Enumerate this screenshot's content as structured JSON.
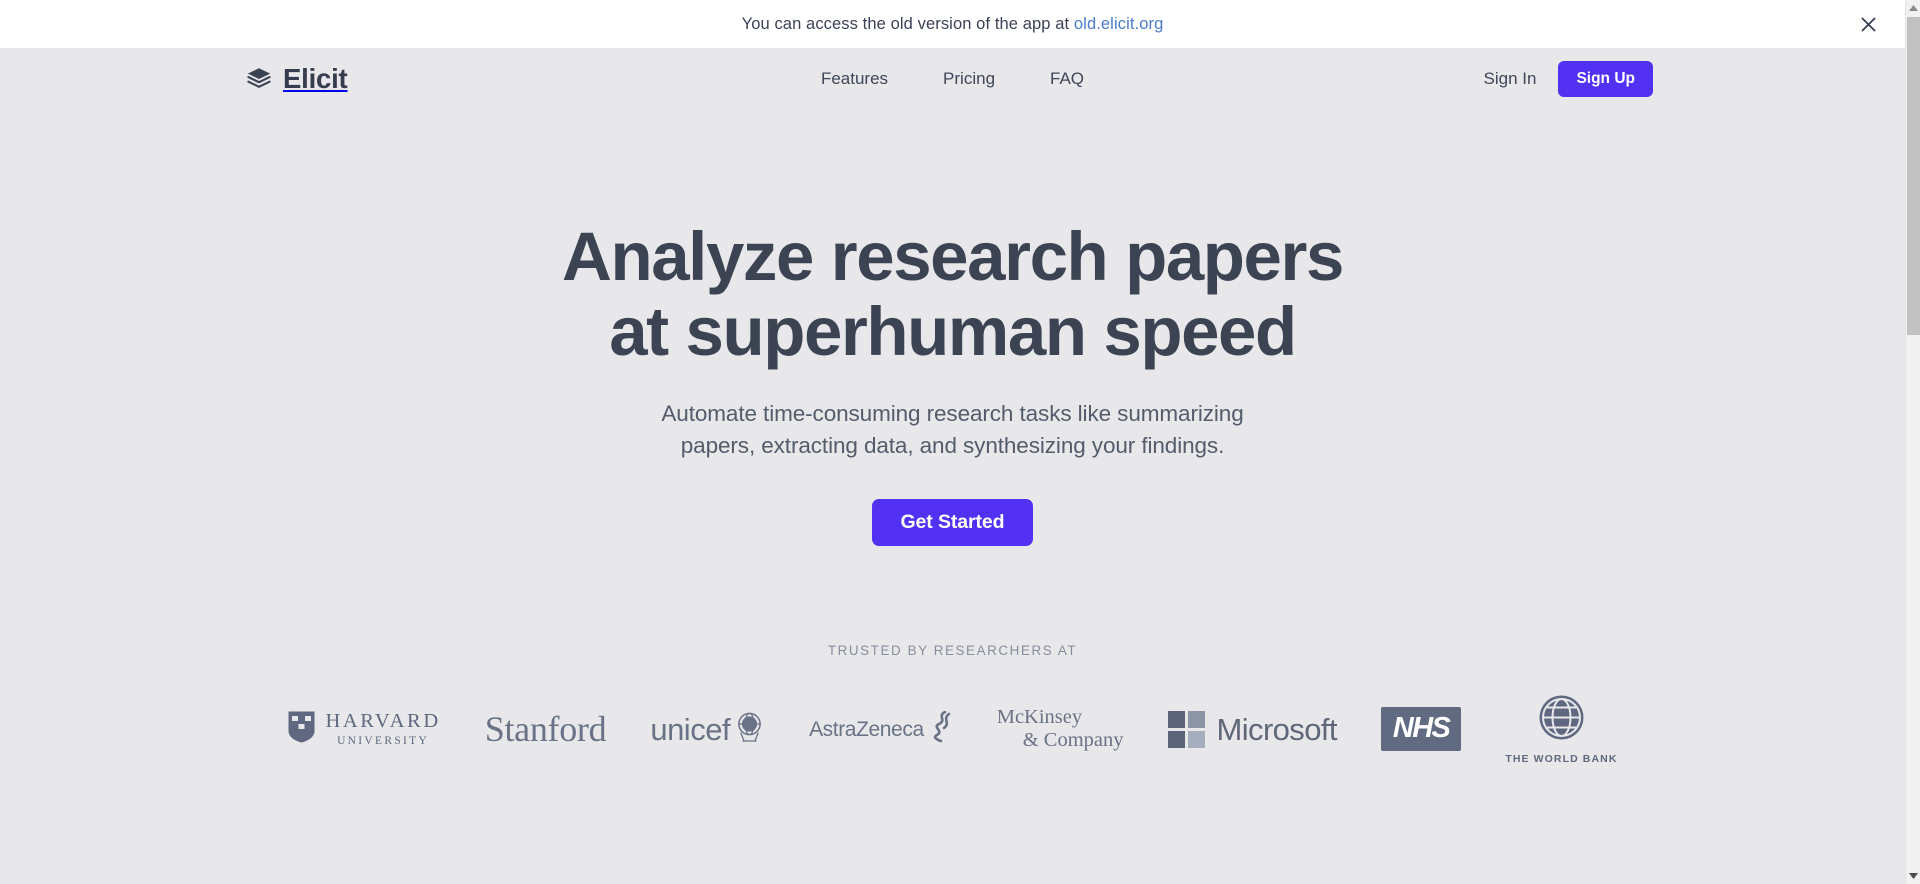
{
  "banner": {
    "text_before": "You can access the old version of the app at ",
    "link_label": "old.elicit.org",
    "close_icon": "close-icon"
  },
  "header": {
    "brand": {
      "name": "Elicit",
      "icon": "stacked-layers-icon"
    },
    "nav": [
      {
        "label": "Features"
      },
      {
        "label": "Pricing"
      },
      {
        "label": "FAQ"
      }
    ],
    "sign_in_label": "Sign In",
    "sign_up_label": "Sign Up"
  },
  "hero": {
    "title_line1": "Analyze research papers",
    "title_line2": "at superhuman speed",
    "subtitle_line1": "Automate time-consuming research tasks like summarizing",
    "subtitle_line2": "papers, extracting data, and synthesizing your findings.",
    "cta_label": "Get Started"
  },
  "trusted": {
    "label": "TRUSTED BY RESEARCHERS AT",
    "logos": [
      {
        "name": "harvard",
        "line1": "HARVARD",
        "line2": "UNIVERSITY"
      },
      {
        "name": "stanford",
        "line1": "Stanford"
      },
      {
        "name": "unicef",
        "line1": "unicef"
      },
      {
        "name": "astrazeneca",
        "line1": "AstraZeneca"
      },
      {
        "name": "mckinsey",
        "line1": "McKinsey",
        "line2": "& Company"
      },
      {
        "name": "microsoft",
        "line1": "Microsoft"
      },
      {
        "name": "nhs",
        "line1": "NHS"
      },
      {
        "name": "world-bank",
        "line1": "THE WORLD BANK"
      }
    ]
  },
  "colors": {
    "accent": "#5231f2",
    "page_bg": "#e8e8ea",
    "banner_bg": "#ffffff",
    "heading": "#3c4454",
    "body_text": "#545c6c",
    "logo_gray": "#6a7287",
    "banner_link": "#4a7cc9"
  }
}
